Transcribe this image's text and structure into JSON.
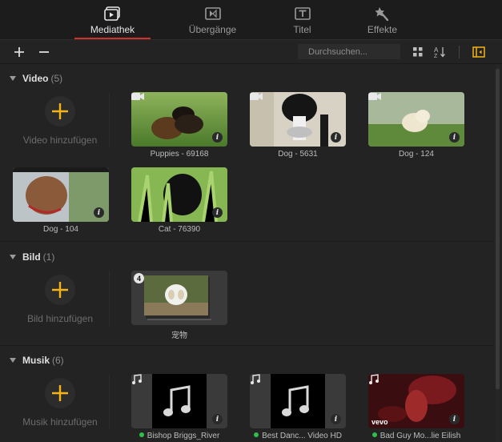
{
  "tabs": [
    {
      "label": "Mediathek",
      "icon": "media-library-icon",
      "active": true
    },
    {
      "label": "Übergänge",
      "icon": "transitions-icon"
    },
    {
      "label": "Titel",
      "icon": "title-icon"
    },
    {
      "label": "Effekte",
      "icon": "effects-icon"
    }
  ],
  "toolbar": {
    "search_placeholder": "Durchsuchen...",
    "add_icon": "plus-icon",
    "remove_icon": "minus-icon",
    "grid_icon": "grid-view-icon",
    "sort_icon": "sort-icon",
    "panel_icon": "panel-toggle-icon"
  },
  "colors": {
    "accent": "#f6b417",
    "active_tab_underline": "#d32f2f",
    "audio_dot": "#2fbf4a"
  },
  "sections": {
    "video": {
      "name": "Video",
      "count": "(5)",
      "add_label": "Video hinzufügen",
      "items": [
        {
          "label": "Puppies - 69168"
        },
        {
          "label": "Dog - 5631"
        },
        {
          "label": "Dog - 124"
        },
        {
          "label": "Dog - 104"
        },
        {
          "label": "Cat - 76390"
        }
      ]
    },
    "bild": {
      "name": "Bild",
      "count": "(1)",
      "add_label": "Bild hinzufügen",
      "items": [
        {
          "label": "宠物",
          "stack_count": "4"
        }
      ]
    },
    "musik": {
      "name": "Musik",
      "count": "(6)",
      "add_label": "Musik hinzufügen",
      "items": [
        {
          "label": "Bishop Briggs_River"
        },
        {
          "label": "Best Danc... Video HD"
        },
        {
          "label": "Bad Guy Mo...lie Eilish",
          "watermark": "vevo"
        }
      ]
    }
  }
}
